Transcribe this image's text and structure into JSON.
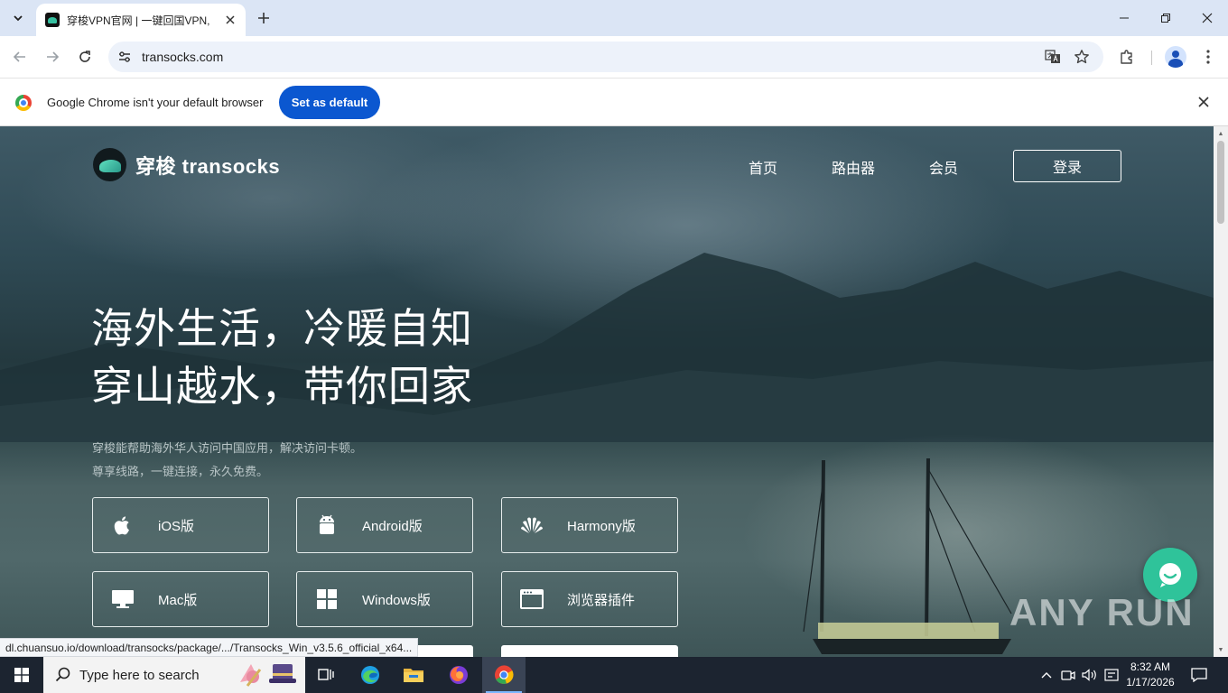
{
  "browser": {
    "tab_title": "穿梭VPN官网 | 一键回国VPN,",
    "url": "transocks.com",
    "infobar_text": "Google Chrome isn't your default browser",
    "set_default_label": "Set as default"
  },
  "site": {
    "brand": "穿梭 transocks",
    "nav": [
      "首页",
      "路由器",
      "会员"
    ],
    "login_label": "登录",
    "headline": [
      "海外生活，冷暖自知",
      "穿山越水，带你回家"
    ],
    "subtitle": [
      "穿梭能帮助海外华人访问中国应用，解决访问卡顿。",
      "尊享线路，一键连接，永久免费。"
    ],
    "downloads": [
      {
        "label": "iOS版",
        "icon": "apple-icon"
      },
      {
        "label": "Android版",
        "icon": "android-icon"
      },
      {
        "label": "Harmony版",
        "icon": "huawei-icon"
      },
      {
        "label": "Mac版",
        "icon": "monitor-icon"
      },
      {
        "label": "Windows版",
        "icon": "windows-icon"
      },
      {
        "label": "浏览器插件",
        "icon": "browser-window-icon"
      }
    ],
    "watermark": "ANY RUN"
  },
  "status_url": "dl.chuansuo.io/download/transocks/package/.../Transocks_Win_v3.5.6_official_x64...",
  "taskbar": {
    "search_placeholder": "Type here to search",
    "time": "8:32 AM",
    "date": "1/17/2026"
  },
  "colors": {
    "accent_blue": "#0b57d0",
    "chat_green": "#2fc39a",
    "taskbar": "#1c2430"
  }
}
